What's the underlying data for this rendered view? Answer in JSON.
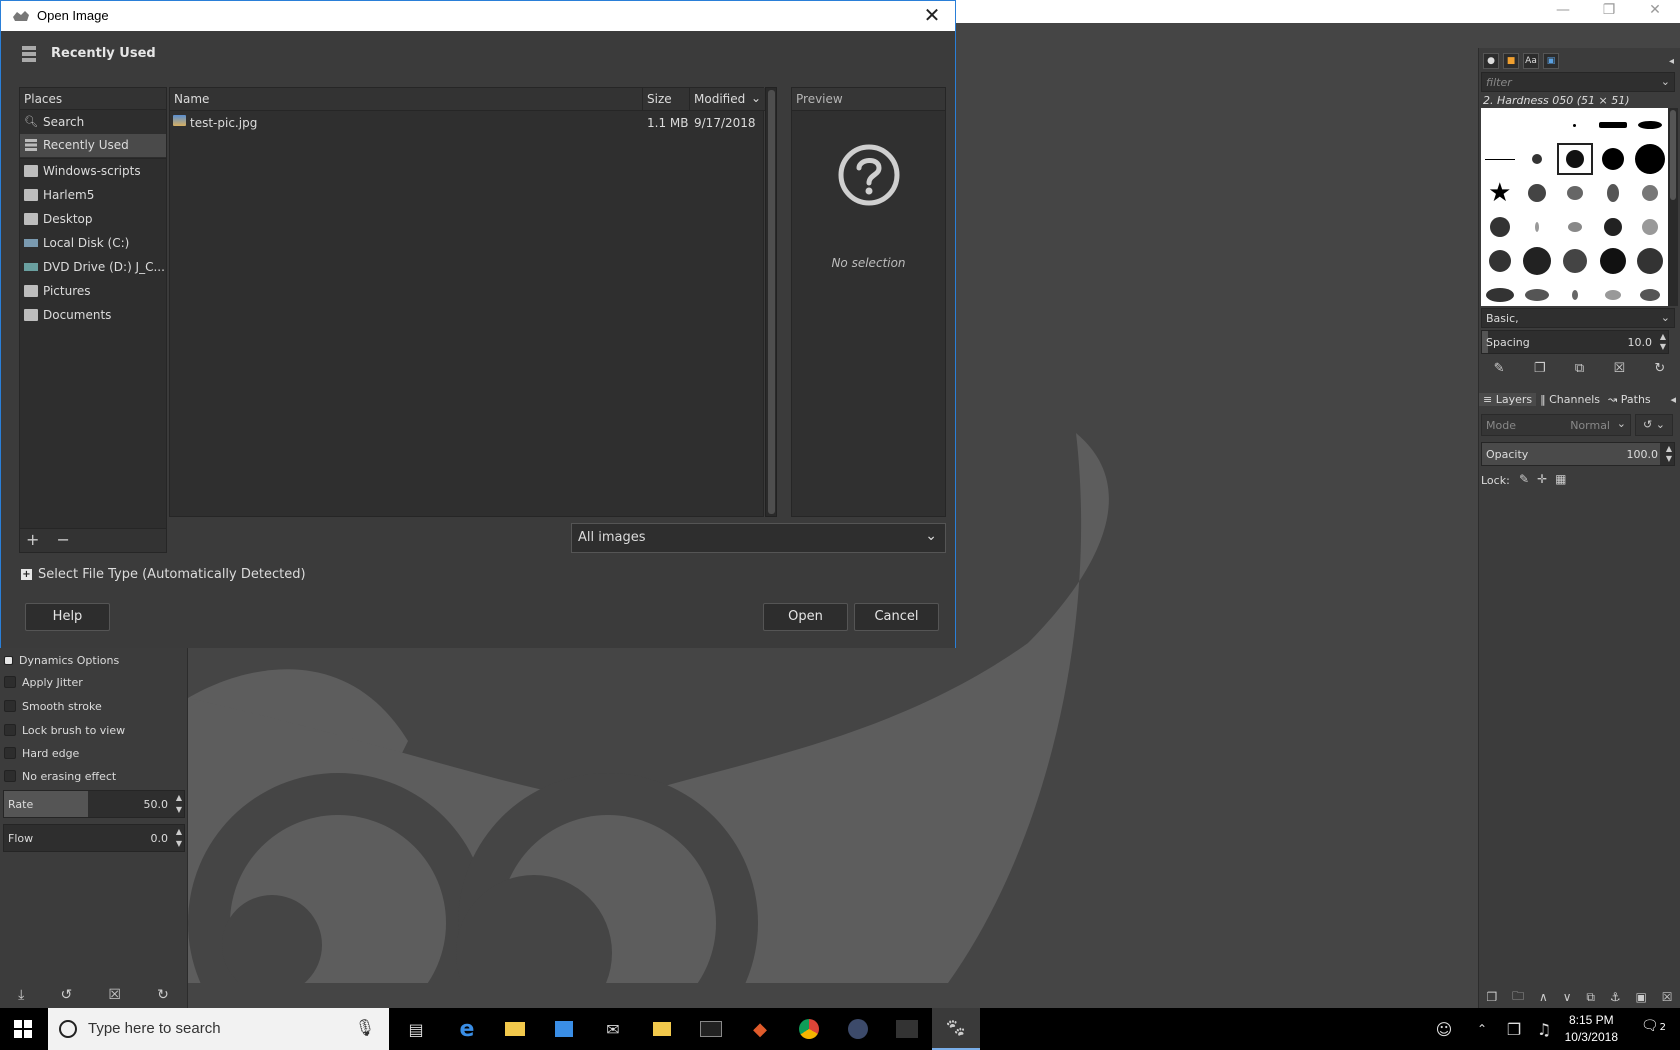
{
  "dialog": {
    "title": "Open Image",
    "location": "Recently Used",
    "places_header": "Places",
    "places": [
      {
        "label": "Search",
        "icon": "search-icon"
      },
      {
        "label": "Recently Used",
        "icon": "recent-icon",
        "selected": true
      },
      {
        "label": "Windows-scripts",
        "icon": "folder-icon"
      },
      {
        "label": "Harlem5",
        "icon": "folder-icon"
      },
      {
        "label": "Desktop",
        "icon": "folder-icon"
      },
      {
        "label": "Local Disk (C:)",
        "icon": "drive-icon"
      },
      {
        "label": "DVD Drive (D:) J_C...",
        "icon": "dvd-icon"
      },
      {
        "label": "Pictures",
        "icon": "folder-icon"
      },
      {
        "label": "Documents",
        "icon": "folder-icon"
      }
    ],
    "places_footer": {
      "add": "+",
      "remove": "−"
    },
    "columns": {
      "name": "Name",
      "size": "Size",
      "modified": "Modified"
    },
    "files": [
      {
        "name": "test-pic.jpg",
        "size": "1.1 MB",
        "modified": "9/17/2018"
      }
    ],
    "preview_header": "Preview",
    "preview_empty": "No selection",
    "filter_value": "All images",
    "file_type_toggle": "Select File Type (Automatically Detected)",
    "buttons": {
      "help": "Help",
      "open": "Open",
      "cancel": "Cancel"
    }
  },
  "tool_options": {
    "section": "Dynamics Options",
    "checkboxes": [
      "Apply Jitter",
      "Smooth stroke",
      "Lock brush to view",
      "Hard edge",
      "No erasing effect"
    ],
    "rate": {
      "label": "Rate",
      "value": "50.0",
      "fraction": 0.5
    },
    "flow": {
      "label": "Flow",
      "value": "0.0",
      "fraction": 0.0
    }
  },
  "right_dock": {
    "filter_placeholder": "filter",
    "brush_name": "2. Hardness 050 (51 × 51)",
    "brush_set": "Basic,",
    "spacing": {
      "label": "Spacing",
      "value": "10.0"
    },
    "layer_tabs": [
      "Layers",
      "Channels",
      "Paths"
    ],
    "mode": {
      "label": "Mode",
      "value": "Normal"
    },
    "opacity": {
      "label": "Opacity",
      "value": "100.0"
    },
    "lock_label": "Lock:"
  },
  "taskbar": {
    "search_placeholder": "Type here to search",
    "time": "8:15 PM",
    "date": "10/3/2018",
    "notification_count": "2"
  },
  "colors": {
    "accent": "#2a7fd8",
    "dialog_bg": "#3b3b3b",
    "gimp_bg": "#454545"
  }
}
